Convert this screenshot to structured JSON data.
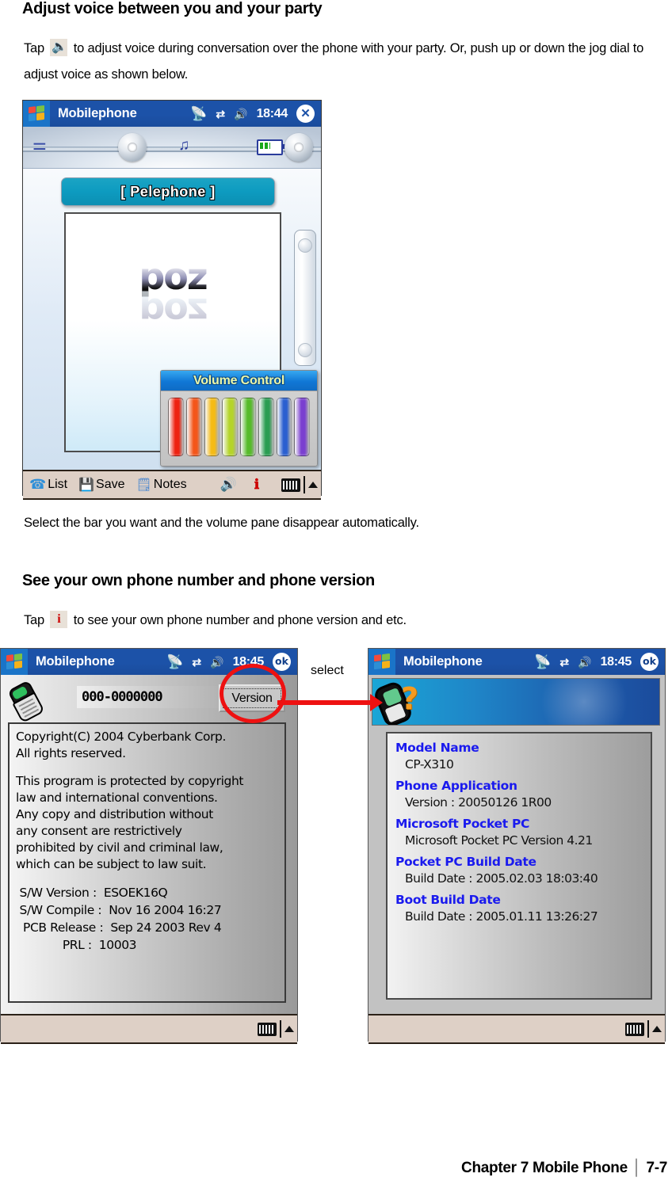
{
  "doc": {
    "heading1": "Adjust voice between you and your party",
    "para1_before": "Tap",
    "para1_after": "to adjust voice during conversation over the phone with your party. Or, push up or down the jog dial to adjust voice as shown below.",
    "caption1": "Select the bar you want and the volume pane disappear automatically.",
    "heading2": "See your own phone number and phone version",
    "para2_before": "Tap",
    "para2_after": "to see your own phone number and phone version and etc.",
    "icon_speaker": "speaker-icon",
    "icon_info": "info-icon"
  },
  "device_call": {
    "titlebar": {
      "start_icon": "windows-start-icon",
      "title": "Mobilephone",
      "signal_icon": "antenna-icon",
      "connection_icon": "connectivity-icon",
      "volume_icon": "speaker-icon",
      "time": "18:44",
      "close_icon": "close-icon",
      "close_label": "✕"
    },
    "hardware": {
      "antenna_icon": "antenna-icon",
      "music_icon": "music-note-icon",
      "battery_icon": "battery-icon",
      "knob_left_icon": "jog-knob-icon",
      "knob_right_icon": "jog-knob-icon",
      "side_rail_icon": "side-jog-rail-icon"
    },
    "carrier_banner": "[ Pelephone ]",
    "logo_text": "poz",
    "logo_reflection": "poz",
    "volume_pane": {
      "title": "Volume Control",
      "bars": [
        {
          "name": "bar-1",
          "color": "#ee2211"
        },
        {
          "name": "bar-2",
          "color": "#f4561a"
        },
        {
          "name": "bar-3",
          "color": "#f5bb15"
        },
        {
          "name": "bar-4",
          "color": "#b5d42a"
        },
        {
          "name": "bar-5",
          "color": "#56bb2a"
        },
        {
          "name": "bar-6",
          "color": "#2a9d52"
        },
        {
          "name": "bar-7",
          "color": "#2a5fd0"
        },
        {
          "name": "bar-8",
          "color": "#7a3fd0"
        }
      ]
    },
    "softbar": {
      "list_label": "List",
      "list_icon": "phone-handset-icon",
      "save_label": "Save",
      "save_icon": "floppy-disk-icon",
      "notes_label": "Notes",
      "notes_icon": "notepad-icon",
      "volume_icon": "speaker-icon",
      "info_icon": "info-icon",
      "keyboard_icon": "keyboard-icon",
      "sip_arrow_icon": "chevron-up-icon"
    }
  },
  "device_about": {
    "titlebar": {
      "start_icon": "windows-start-icon",
      "title": "Mobilephone",
      "signal_icon": "antenna-icon",
      "connection_icon": "connectivity-icon",
      "volume_icon": "speaker-icon",
      "time": "18:45",
      "ok_label": "ok"
    },
    "phone_icon": "mobile-phone-icon",
    "phone_number": "000-0000000",
    "version_button": "Version",
    "copyright": "Copyright(C) 2004 Cyberbank Corp.\nAll rights reserved.",
    "legal": "This program is protected by copyright\nlaw and international conventions.\nAny copy and distribution without\nany consent are restrictively\nprohibited by civil and criminal law,\nwhich can be subject to law suit.",
    "specs": " S/W Version :  ESOEK16Q\n S/W Compile :  Nov 16 2004 16:27\n  PCB Release :  Sep 24 2003 Rev 4\n             PRL :  10003",
    "softbar": {
      "keyboard_icon": "keyboard-icon",
      "sip_arrow_icon": "chevron-up-icon"
    }
  },
  "device_version": {
    "titlebar": {
      "start_icon": "windows-start-icon",
      "title": "Mobilephone",
      "signal_icon": "antenna-icon",
      "connection_icon": "connectivity-icon",
      "volume_icon": "speaker-icon",
      "time": "18:45",
      "ok_label": "ok"
    },
    "banner_icon": "phone-question-icon",
    "items": [
      {
        "heading": "Model Name",
        "value": "CP-X310"
      },
      {
        "heading": "Phone Application",
        "value": "Version : 20050126 1R00"
      },
      {
        "heading": "Microsoft Pocket PC",
        "value": "Microsoft Pocket PC Version 4.21"
      },
      {
        "heading": "Pocket PC Build Date",
        "value": "Build Date : 2005.02.03 18:03:40"
      },
      {
        "heading": "Boot Build Date",
        "value": "Build Date : 2005.01.11 13:26:27"
      }
    ],
    "softbar": {
      "keyboard_icon": "keyboard-icon",
      "sip_arrow_icon": "chevron-up-icon"
    }
  },
  "annotation": {
    "label": "select",
    "circle_color": "#ee1111",
    "arrow_color": "#ee1111"
  },
  "footer": {
    "chapter": "Chapter 7 Mobile Phone",
    "separator": "│",
    "page": "7-7"
  }
}
